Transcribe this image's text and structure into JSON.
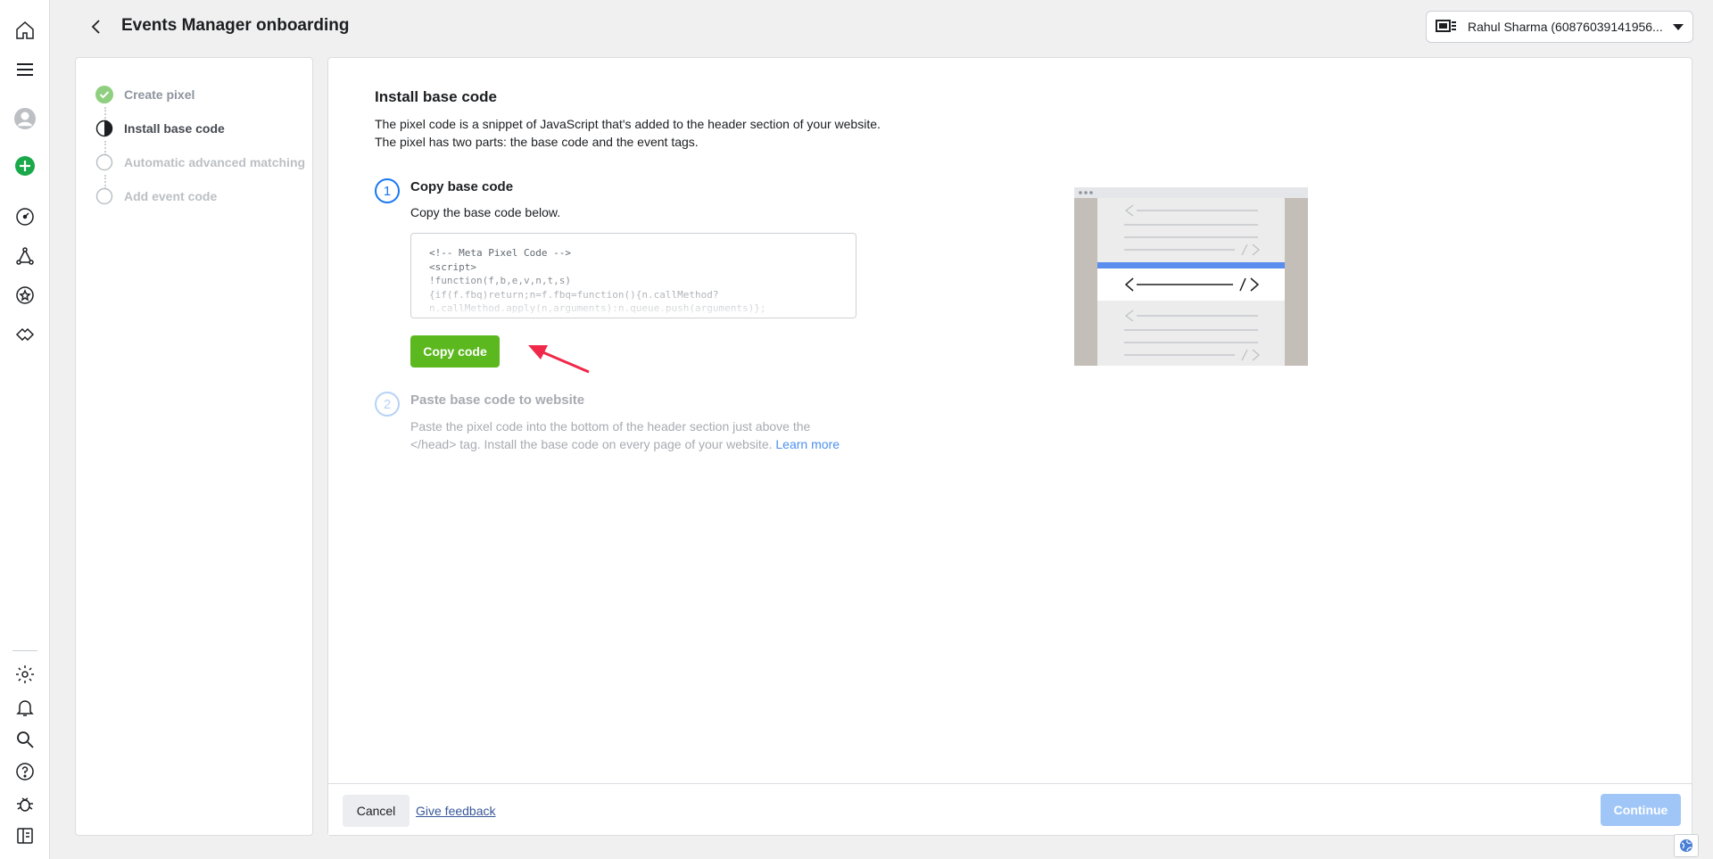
{
  "header": {
    "title": "Events Manager onboarding",
    "account_label": "Rahul Sharma (60876039141956..."
  },
  "steps": [
    {
      "label": "Create pixel",
      "status": "complete"
    },
    {
      "label": "Install base code",
      "status": "current"
    },
    {
      "label": "Automatic advanced matching",
      "status": "pending"
    },
    {
      "label": "Add event code",
      "status": "pending"
    }
  ],
  "main": {
    "title": "Install base code",
    "desc_line1": "The pixel code is a snippet of JavaScript that's added to the header section of your website.",
    "desc_line2": "The pixel has two parts: the base code and the event tags.",
    "step1": {
      "number": "1",
      "title": "Copy base code",
      "desc": "Copy the base code below.",
      "code_lines": [
        "<!-- Meta Pixel Code -->",
        "<script>",
        "!function(f,b,e,v,n,t,s)",
        "{if(f.fbq)return;n=f.fbq=function(){n.callMethod?",
        "n.callMethod.apply(n,arguments):n.queue.push(arguments)};"
      ],
      "copy_label": "Copy code"
    },
    "step2": {
      "number": "2",
      "title": "Paste base code to website",
      "desc_line1": "Paste the pixel code into the bottom of the header section just above the",
      "desc_line2_prefix": "</head> tag. Install the base code on every page of your website.",
      "learn_more": "Learn more"
    }
  },
  "footer": {
    "cancel": "Cancel",
    "feedback": "Give feedback",
    "continue": "Continue"
  },
  "colors": {
    "primary": "#1877f2",
    "success": "#5cb81f",
    "disabled_primary": "#9fc6f7",
    "annotation": "#f02849"
  },
  "rail_icons": [
    "home-icon",
    "menu-icon",
    "avatar",
    "create-icon",
    "dashboard-icon",
    "events-icon",
    "star-icon",
    "partner-icon",
    "settings-icon",
    "notifications-icon",
    "search-icon",
    "help-icon",
    "bug-icon",
    "sidebar-toggle-icon"
  ]
}
